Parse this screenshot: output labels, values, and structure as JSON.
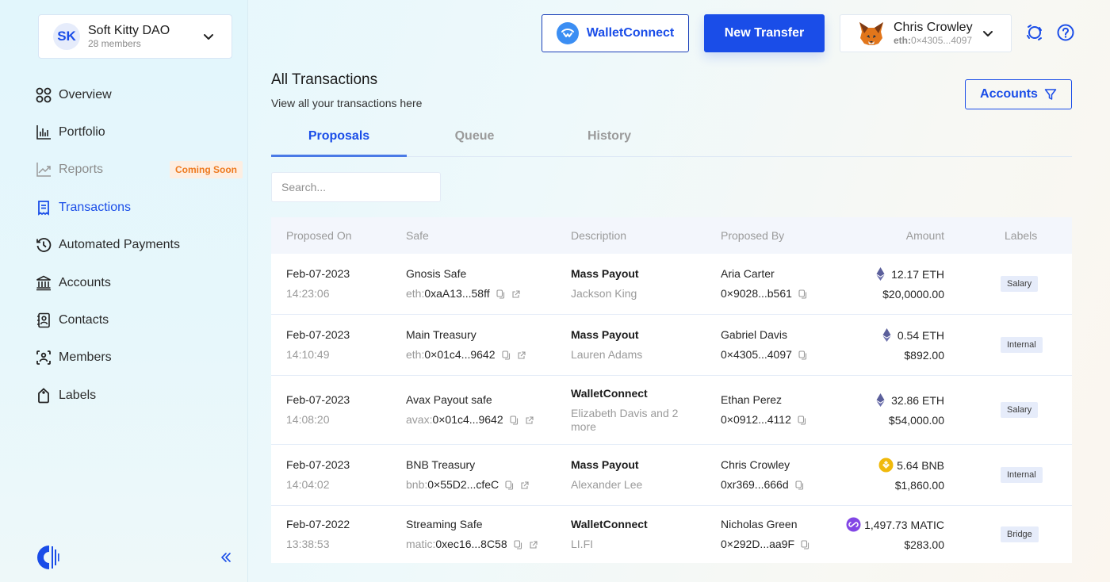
{
  "org": {
    "initials": "SK",
    "name": "Soft Kitty DAO",
    "members": "28 members"
  },
  "sidebar": {
    "items": [
      {
        "label": "Overview",
        "icon": "grid-icon",
        "state": "normal"
      },
      {
        "label": "Portfolio",
        "icon": "bar-chart-icon",
        "state": "normal"
      },
      {
        "label": "Reports",
        "icon": "trend-chart-icon",
        "state": "disabled",
        "badge": "Coming Soon"
      },
      {
        "label": "Transactions",
        "icon": "receipt-icon",
        "state": "active"
      },
      {
        "label": "Automated Payments",
        "icon": "history-clock-icon",
        "state": "normal"
      },
      {
        "label": "Accounts",
        "icon": "bank-icon",
        "state": "normal"
      },
      {
        "label": "Contacts",
        "icon": "contact-book-icon",
        "state": "normal"
      },
      {
        "label": "Members",
        "icon": "members-scan-icon",
        "state": "normal"
      },
      {
        "label": "Labels",
        "icon": "tag-icon",
        "state": "normal"
      }
    ],
    "collapse_label": "«"
  },
  "topbar": {
    "walletconnect_label": "WalletConnect",
    "new_transfer_label": "New Transfer",
    "user": {
      "name": "Chris Crowley",
      "chain_prefix": "eth:",
      "address": "0×4305...4097"
    }
  },
  "header": {
    "title": "All Transactions",
    "subtitle": "View all your transactions here",
    "accounts_filter_label": "Accounts"
  },
  "tabs": [
    {
      "label": "Proposals",
      "active": true
    },
    {
      "label": "Queue",
      "active": false
    },
    {
      "label": "History",
      "active": false
    }
  ],
  "search": {
    "placeholder": "Search...",
    "value": ""
  },
  "table": {
    "columns": [
      "Proposed On",
      "Safe",
      "Description",
      "Proposed By",
      "Amount",
      "Labels"
    ],
    "rows": [
      {
        "date": "Feb-07-2023",
        "time": "14:23:06",
        "safe_name": "Gnosis Safe",
        "chain": "eth:",
        "safe_address": "0xaA13...58ff",
        "desc_title": "Mass Payout",
        "desc_sub": "Jackson King",
        "proposer": "Aria Carter",
        "proposer_address": "0×9028...b561",
        "coin": "eth",
        "amount_token": "12.17 ETH",
        "amount_usd": "$20,0000.00",
        "label": "Salary"
      },
      {
        "date": "Feb-07-2023",
        "time": "14:10:49",
        "safe_name": "Main Treasury",
        "chain": "eth:",
        "safe_address": "0×01c4...9642",
        "desc_title": "Mass Payout",
        "desc_sub": "Lauren Adams",
        "proposer": "Gabriel Davis",
        "proposer_address": "0×4305...4097",
        "coin": "eth",
        "amount_token": "0.54 ETH",
        "amount_usd": "$892.00",
        "label": "Internal"
      },
      {
        "date": "Feb-07-2023",
        "time": "14:08:20",
        "safe_name": "Avax Payout safe",
        "chain": "avax:",
        "safe_address": "0×01c4...9642",
        "desc_title": "WalletConnect",
        "desc_sub": "Elizabeth Davis and 2 more",
        "proposer": "Ethan Perez",
        "proposer_address": "0×0912...4112",
        "coin": "eth",
        "amount_token": "32.86 ETH",
        "amount_usd": "$54,000.00",
        "label": "Salary"
      },
      {
        "date": "Feb-07-2023",
        "time": "14:04:02",
        "safe_name": "BNB Treasury",
        "chain": "bnb:",
        "safe_address": "0×55D2...cfeC",
        "desc_title": "Mass Payout",
        "desc_sub": "Alexander Lee",
        "proposer": "Chris Crowley",
        "proposer_address": "0xr369...666d",
        "coin": "bnb",
        "amount_token": "5.64 BNB",
        "amount_usd": "$1,860.00",
        "label": "Internal"
      },
      {
        "date": "Feb-07-2022",
        "time": "13:38:53",
        "safe_name": "Streaming Safe",
        "chain": "matic:",
        "safe_address": "0xec16...8C58",
        "desc_title": "WalletConnect",
        "desc_sub": "LI.FI",
        "proposer": "Nicholas Green",
        "proposer_address": "0×292D...aa9F",
        "coin": "matic",
        "amount_token": "1,497.73 MATIC",
        "amount_usd": "$283.00",
        "label": "Bridge"
      }
    ]
  },
  "colors": {
    "accent": "#1a4de8",
    "badge_orange": "#ee7a1f",
    "eth": "#5b5f9b",
    "bnb": "#f0b90b",
    "matic": "#8247e5",
    "chip_bg": "#e6ecfa"
  }
}
